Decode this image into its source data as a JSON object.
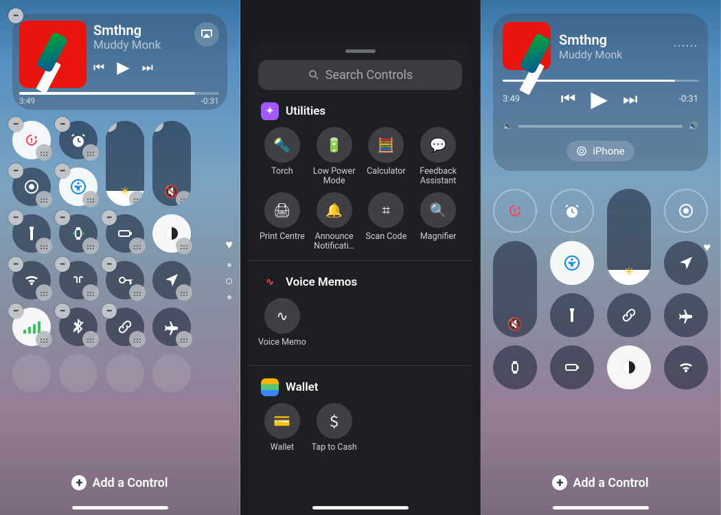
{
  "panel1": {
    "now_playing": {
      "title": "Smthng",
      "artist": "Muddy Monk",
      "elapsed": "3:49",
      "remaining": "-0:31",
      "progress_pct": 88
    },
    "add_control": "Add a Control",
    "tiles": [
      {
        "id": "rotation-lock",
        "active": true
      },
      {
        "id": "alarm"
      },
      {
        "id": "brightness-slider",
        "slider": true,
        "level": 18,
        "active": true,
        "glyph": "☀"
      },
      {
        "id": "volume-slider",
        "slider": true,
        "level": 0,
        "glyph": "🔇"
      },
      {
        "id": "screen-record"
      },
      {
        "id": "accessibility",
        "active": true
      },
      {
        "id": "flashlight"
      },
      {
        "id": "watch"
      },
      {
        "id": "low-power"
      },
      {
        "id": "dark-mode",
        "active": true
      },
      {
        "id": "wifi"
      },
      {
        "id": "airpods"
      },
      {
        "id": "passwords"
      },
      {
        "id": "location"
      },
      {
        "id": "cellular",
        "active": true
      },
      {
        "id": "bluetooth"
      },
      {
        "id": "link"
      },
      {
        "id": "airplane"
      }
    ]
  },
  "panel2": {
    "search_placeholder": "Search Controls",
    "sections": [
      {
        "title": "Utilities",
        "items": [
          {
            "label": "Torch",
            "icon": "flashlight"
          },
          {
            "label": "Low Power Mode",
            "icon": "battery"
          },
          {
            "label": "Calculator",
            "icon": "calculator"
          },
          {
            "label": "Feedback Assistant",
            "icon": "feedback"
          },
          {
            "label": "Print Centre",
            "icon": "printer"
          },
          {
            "label": "Announce Notificati…",
            "icon": "bell"
          },
          {
            "label": "Scan Code",
            "icon": "qr"
          },
          {
            "label": "Magnifier",
            "icon": "magnifier"
          }
        ]
      },
      {
        "title": "Voice Memos",
        "items": [
          {
            "label": "Voice Memo",
            "icon": "waveform"
          }
        ]
      },
      {
        "title": "Wallet",
        "items": [
          {
            "label": "Wallet",
            "icon": "wallet"
          },
          {
            "label": "Tap to Cash",
            "icon": "cash"
          }
        ]
      }
    ]
  },
  "panel3": {
    "now_playing": {
      "title": "Smthng",
      "artist": "Muddy Monk",
      "elapsed": "3:49",
      "remaining": "-0:31",
      "device": "iPhone",
      "progress_pct": 88
    },
    "add_control": "Add a Control",
    "tiles": [
      {
        "id": "rotation-lock",
        "active": true,
        "outlined": true
      },
      {
        "id": "alarm",
        "outlined": true
      },
      {
        "id": "brightness-slider",
        "slider": true,
        "level": 16,
        "glyph": "☀"
      },
      {
        "id": "screen-record",
        "outlined": true
      },
      {
        "id": "volume-slider",
        "slider": true,
        "level": 0,
        "glyph": "🔇",
        "span_from_row": 2
      },
      {
        "id": "accessibility",
        "active": true
      },
      {
        "id": "location"
      },
      {
        "id": "flashlight"
      },
      {
        "id": "link"
      },
      {
        "id": "airplane"
      },
      {
        "id": "watch"
      },
      {
        "id": "low-power"
      },
      {
        "id": "dark-mode",
        "active": true
      },
      {
        "id": "wifi"
      }
    ]
  }
}
